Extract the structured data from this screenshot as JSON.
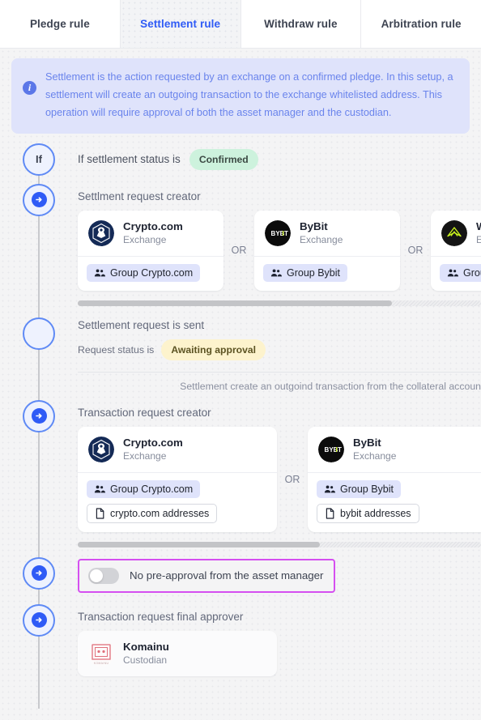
{
  "tabs": [
    {
      "label": "Pledge rule",
      "active": false
    },
    {
      "label": "Settlement rule",
      "active": true
    },
    {
      "label": "Withdraw rule",
      "active": false
    },
    {
      "label": "Arbitration rule",
      "active": false
    }
  ],
  "banner": {
    "icon": "info-icon",
    "text": "Settlement is the action requested by an exchange on a confirmed pledge. In this setup, a settlement will create an outgoing transaction to the exchange whitelisted address. This operation will require approval of both the asset manager and the custodian."
  },
  "condition": {
    "node_label": "If",
    "label": "If settlement status is",
    "status_value": "Confirmed"
  },
  "settlement_creator": {
    "title": "Settlment request creator",
    "or_label": "OR",
    "cards": [
      {
        "name": "Crypto.com",
        "type": "Exchange",
        "logo": "crypto-com-logo",
        "group": "Group Crypto.com"
      },
      {
        "name": "ByBit",
        "type": "Exchange",
        "logo": "bybit-logo",
        "group": "Group Bybit"
      },
      {
        "name": "Wi",
        "type": "Exc",
        "logo": "wintermute-logo",
        "group": "Group"
      }
    ],
    "scroll_percent": 78
  },
  "request_sent": {
    "title": "Settlement request is sent",
    "status_label": "Request status is",
    "status_value": "Awaiting approval"
  },
  "note": "Settlement create an outgoind transaction from the collateral accoun",
  "transaction_creator": {
    "title": "Transaction request creator",
    "or_label": "OR",
    "cards": [
      {
        "name": "Crypto.com",
        "type": "Exchange",
        "logo": "crypto-com-logo",
        "group": "Group Crypto.com",
        "address": "crypto.com addresses"
      },
      {
        "name": "ByBit",
        "type": "Exchange",
        "logo": "bybit-logo",
        "group": "Group Bybit",
        "address": "bybit addresses"
      }
    ],
    "scroll_percent": 60
  },
  "pre_approval": {
    "label": "No pre-approval from the asset manager",
    "enabled": false,
    "highlight_color": "#d54ff0"
  },
  "final_approver": {
    "title": "Transaction request final approver",
    "card": {
      "name": "Komainu",
      "type": "Custodian",
      "logo": "komainu-logo"
    }
  },
  "colors": {
    "accent": "#2f5bf6",
    "banner_bg": "#dfe3fb",
    "banner_text": "#6a84ec",
    "green_pill": "#cdf2dd",
    "yellow_pill": "#fdf3cd",
    "highlight": "#d54ff0"
  }
}
